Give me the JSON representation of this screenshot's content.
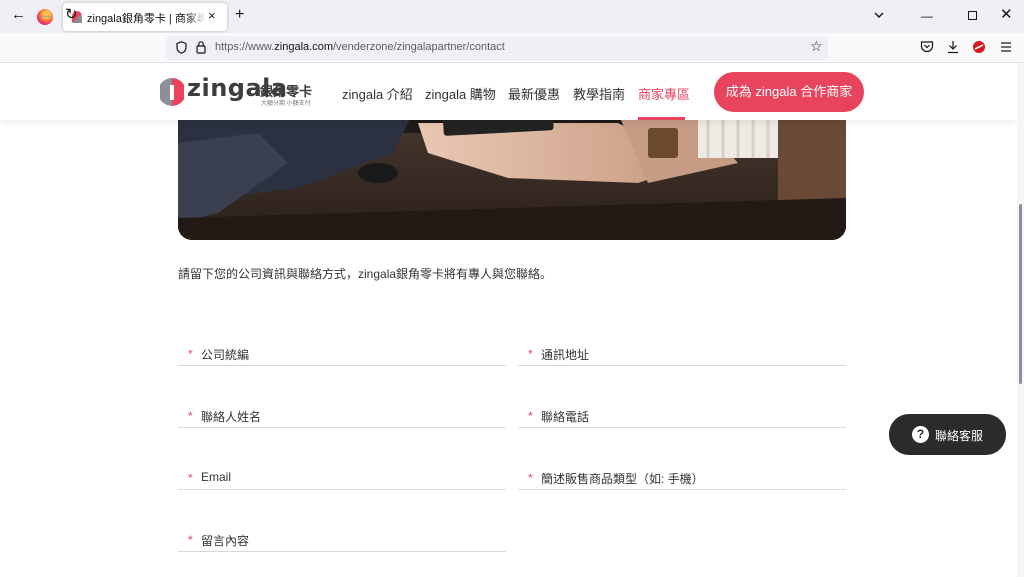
{
  "browser": {
    "tab_title": "zingala銀角零卡 | 商家專人聯繫",
    "tab_close": "×",
    "new_tab": "+",
    "url_prefix": "https://www.",
    "url_domain": "zingala.com",
    "url_path": "/venderzone/zingalapartner/contact",
    "min_glyph": "—",
    "close_glyph": "✕",
    "back_glyph": "←",
    "forward_glyph": "→",
    "reload_glyph": "↻",
    "star_glyph": "☆"
  },
  "header": {
    "logo_text": "zingala",
    "logo_cn": "銀角零卡",
    "logo_sub": "大額分期 小額支付",
    "menu": [
      {
        "label": "zingala 介紹"
      },
      {
        "label": "zingala 購物"
      },
      {
        "label": "最新優惠"
      },
      {
        "label": "教學指南"
      },
      {
        "label": "商家專區"
      }
    ],
    "cta_label": "成為 zingala 合作商家"
  },
  "main": {
    "intro": "請留下您的公司資訊與聯絡方式，zingala銀角零卡將有專人與您聯絡。",
    "required_mark": "*",
    "fields": [
      {
        "label": "公司統編"
      },
      {
        "label": "通訊地址"
      },
      {
        "label": "聯絡人姓名"
      },
      {
        "label": "聯絡電話"
      },
      {
        "label": "Email"
      },
      {
        "label": "簡述販售商品類型（如: 手機）"
      },
      {
        "label": "留言內容"
      }
    ]
  },
  "help": {
    "icon_text": "?",
    "label": "聯絡客服"
  },
  "colors": {
    "accent": "#e8445e",
    "dark_button": "#2b2b2b"
  }
}
